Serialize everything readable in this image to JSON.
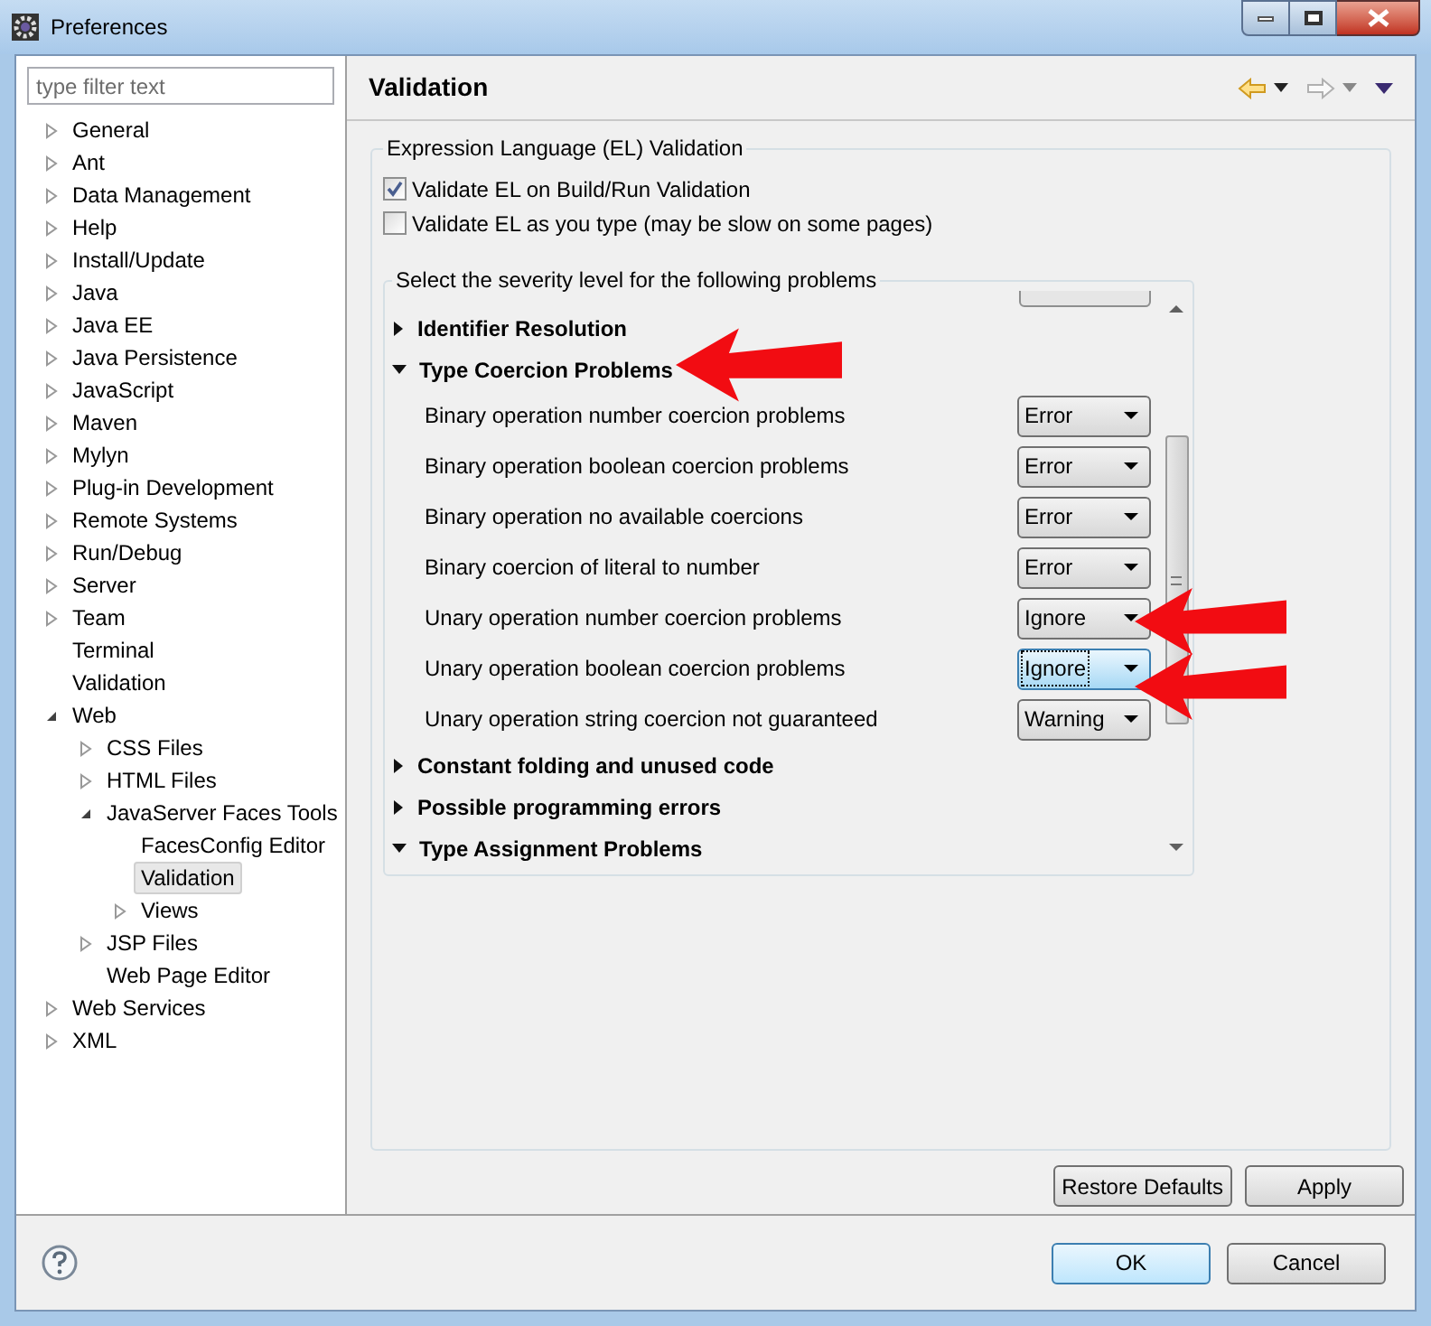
{
  "window": {
    "title": "Preferences"
  },
  "filter": {
    "placeholder": "type filter text"
  },
  "tree": [
    {
      "label": "General",
      "expanded": false,
      "selected": false
    },
    {
      "label": "Ant",
      "expanded": false,
      "selected": false
    },
    {
      "label": "Data Management",
      "expanded": false,
      "selected": false
    },
    {
      "label": "Help",
      "expanded": false,
      "selected": false
    },
    {
      "label": "Install/Update",
      "expanded": false,
      "selected": false
    },
    {
      "label": "Java",
      "expanded": false,
      "selected": false
    },
    {
      "label": "Java EE",
      "expanded": false,
      "selected": false
    },
    {
      "label": "Java Persistence",
      "expanded": false,
      "selected": false
    },
    {
      "label": "JavaScript",
      "expanded": false,
      "selected": false
    },
    {
      "label": "Maven",
      "expanded": false,
      "selected": false
    },
    {
      "label": "Mylyn",
      "expanded": false,
      "selected": false
    },
    {
      "label": "Plug-in Development",
      "expanded": false,
      "selected": false
    },
    {
      "label": "Remote Systems",
      "expanded": false,
      "selected": false
    },
    {
      "label": "Run/Debug",
      "expanded": false,
      "selected": false
    },
    {
      "label": "Server",
      "expanded": false,
      "selected": false
    },
    {
      "label": "Team",
      "expanded": false,
      "selected": false
    },
    {
      "label": "Terminal",
      "selected": false
    },
    {
      "label": "Validation",
      "selected": false
    },
    {
      "label": "Web",
      "expanded": true,
      "selected": false,
      "children": [
        {
          "label": "CSS Files",
          "expanded": false,
          "selected": false
        },
        {
          "label": "HTML Files",
          "expanded": false,
          "selected": false
        },
        {
          "label": "JavaServer Faces Tools",
          "expanded": true,
          "selected": false,
          "children": [
            {
              "label": "FacesConfig Editor",
              "selected": false
            },
            {
              "label": "Validation",
              "selected": true
            },
            {
              "label": "Views",
              "expanded": false,
              "selected": false
            }
          ]
        },
        {
          "label": "JSP Files",
          "expanded": false,
          "selected": false
        },
        {
          "label": "Web Page Editor",
          "selected": false
        }
      ]
    },
    {
      "label": "Web Services",
      "expanded": false,
      "selected": false
    },
    {
      "label": "XML",
      "expanded": false,
      "selected": false
    }
  ],
  "page": {
    "title": "Validation"
  },
  "el_group": {
    "title": "Expression Language (EL) Validation",
    "checkboxes": [
      {
        "label": "Validate EL on Build/Run Validation",
        "checked": true
      },
      {
        "label": "Validate EL as you type (may be slow on some pages)",
        "checked": false
      }
    ]
  },
  "severity_group": {
    "title": "Select the severity level for the following problems",
    "sections": [
      {
        "title": "Identifier Resolution",
        "expanded": false
      },
      {
        "title": "Type Coercion Problems",
        "expanded": true,
        "options": [
          {
            "label": "Binary operation number coercion problems",
            "value": "Error",
            "focused": false
          },
          {
            "label": "Binary operation boolean coercion problems",
            "value": "Error",
            "focused": false
          },
          {
            "label": "Binary operation no available coercions",
            "value": "Error",
            "focused": false
          },
          {
            "label": "Binary coercion of literal to number",
            "value": "Error",
            "focused": false
          },
          {
            "label": "Unary operation number coercion problems",
            "value": "Ignore",
            "focused": false
          },
          {
            "label": "Unary operation boolean coercion problems",
            "value": "Ignore",
            "focused": true
          },
          {
            "label": "Unary operation string coercion not guaranteed",
            "value": "Warning",
            "focused": false
          }
        ]
      },
      {
        "title": "Constant folding and unused code",
        "expanded": false
      },
      {
        "title": "Possible programming errors",
        "expanded": false
      },
      {
        "title": "Type Assignment Problems",
        "expanded": true
      }
    ]
  },
  "page_buttons": [
    "Restore Defaults",
    "Apply"
  ],
  "dialog_buttons": [
    {
      "label": "OK",
      "default": true
    },
    {
      "label": "Cancel",
      "default": false
    }
  ]
}
